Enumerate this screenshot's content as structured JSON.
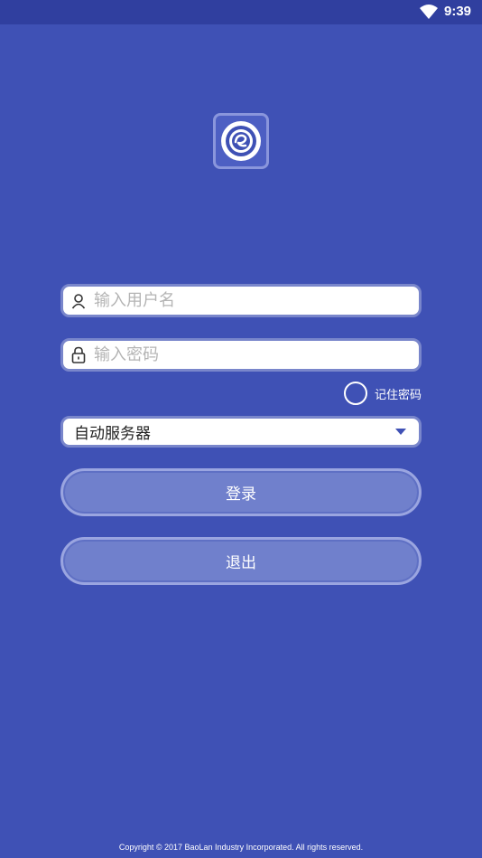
{
  "status_bar": {
    "time": "9:39"
  },
  "login": {
    "username_placeholder": "输入用户名",
    "password_placeholder": "输入密码",
    "remember_label": "记住密码",
    "server_select_value": "自动服务器",
    "login_button": "登录",
    "exit_button": "退出"
  },
  "footer": {
    "copyright": "Copyright © 2017 BaoLan Industry Incorporated. All rights reserved."
  },
  "colors": {
    "background": "#3f51b5",
    "status_bar": "#303f9f",
    "button": "#7080cc"
  }
}
